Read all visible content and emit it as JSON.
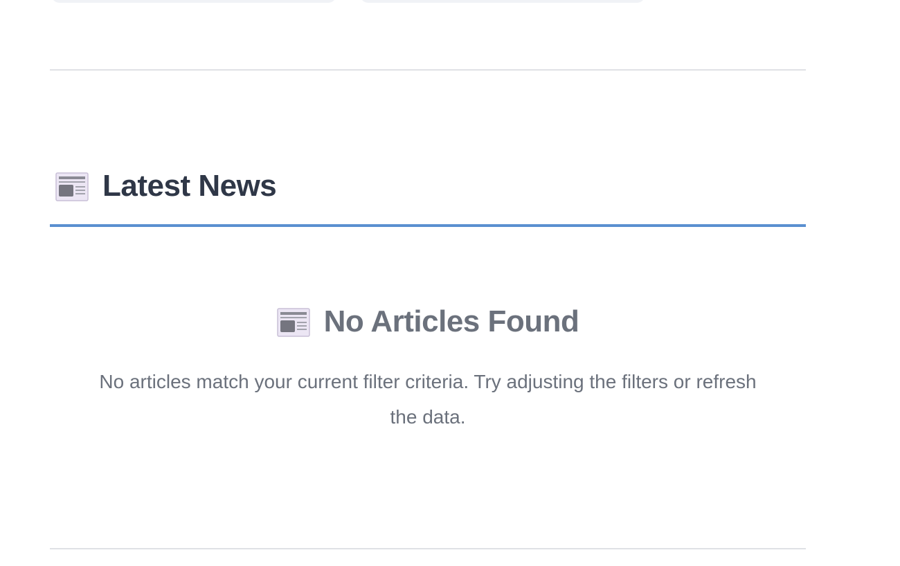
{
  "section": {
    "title": "Latest News",
    "icon": "newspaper-icon",
    "accent_color": "#5a8fd0"
  },
  "empty_state": {
    "icon": "newspaper-icon",
    "title": "No Articles Found",
    "message": "No articles match your current filter criteria. Try adjusting the filters or refresh the data."
  },
  "colors": {
    "heading": "#2f3747",
    "muted_text": "#6b717c",
    "divider": "#dfe1e5",
    "field_bg": "#f0f2f6"
  }
}
